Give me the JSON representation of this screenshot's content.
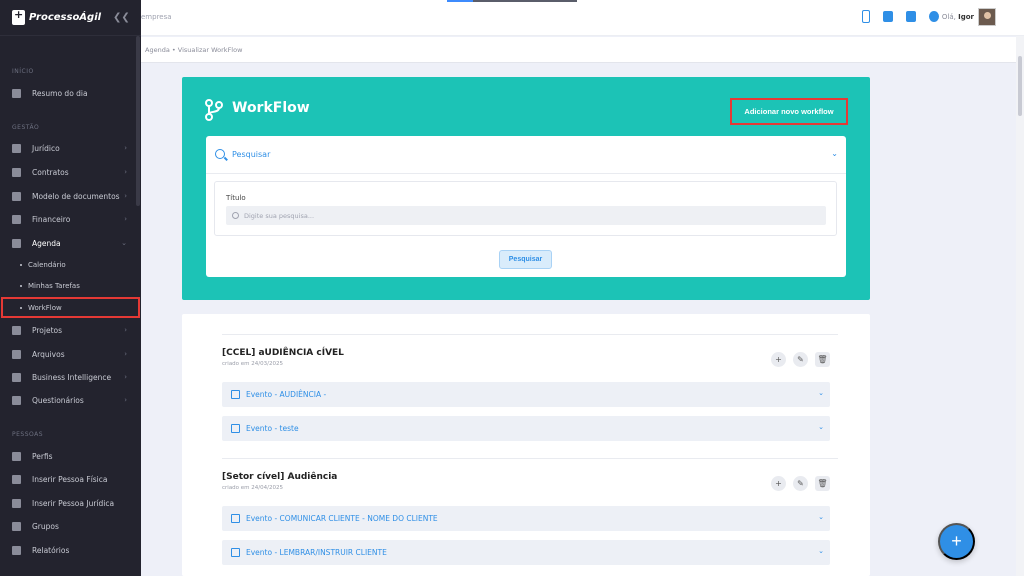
{
  "brand": {
    "name": "ProcessoÁgil"
  },
  "topbar": {
    "company_placeholder": "empresa",
    "greeting_prefix": "Olá,",
    "user_name": "Igor"
  },
  "breadcrumb": {
    "text": "Agenda  •  Visualizar WorkFlow"
  },
  "sidebar": {
    "section_inicio": "INÍCIO",
    "section_gestao": "GESTÃO",
    "section_pessoas": "PESSOAS",
    "resumo": "Resumo do dia",
    "gestao_items": [
      "Jurídico",
      "Contratos",
      "Modelo de documentos",
      "Financeiro",
      "Agenda"
    ],
    "agenda_sub": [
      "Calendário",
      "Minhas Tarefas",
      "WorkFlow"
    ],
    "gestao_items2": [
      "Projetos",
      "Arquivos",
      "Business Intelligence",
      "Questionários"
    ],
    "pessoas_items": [
      "Perfis",
      "Inserir Pessoa Física",
      "Inserir Pessoa Jurídica",
      "Grupos",
      "Relatórios"
    ]
  },
  "hero": {
    "title": "WorkFlow",
    "add_button": "Adicionar novo workflow"
  },
  "search": {
    "header": "Pesquisar",
    "field_label": "Título",
    "field_placeholder": "Digite sua pesquisa...",
    "button": "Pesquisar"
  },
  "workflows": [
    {
      "title": "[CCEL] aUDIÊNCIA cÍVEL",
      "date": "criado em 24/03/2025",
      "events": [
        "Evento - AUDIÊNCIA -",
        "Evento - teste"
      ]
    },
    {
      "title": "[Setor cível] Audiência",
      "date": "criado em 24/04/2025",
      "events": [
        "Evento - COMUNICAR CLIENTE - NOME DO CLIENTE",
        "Evento - LEMBRAR/INSTRUIR CLIENTE"
      ]
    }
  ],
  "fab": {
    "label": "+"
  },
  "colors": {
    "sidebar_bg": "#23232e",
    "hero_bg": "#1cc3b6",
    "accent": "#2f8fe6",
    "highlight": "#e53935"
  },
  "icons": {
    "top": [
      "phone-icon",
      "file-icon",
      "mail-icon",
      "gear-icon"
    ],
    "hero": "workflow-branch-icon"
  }
}
